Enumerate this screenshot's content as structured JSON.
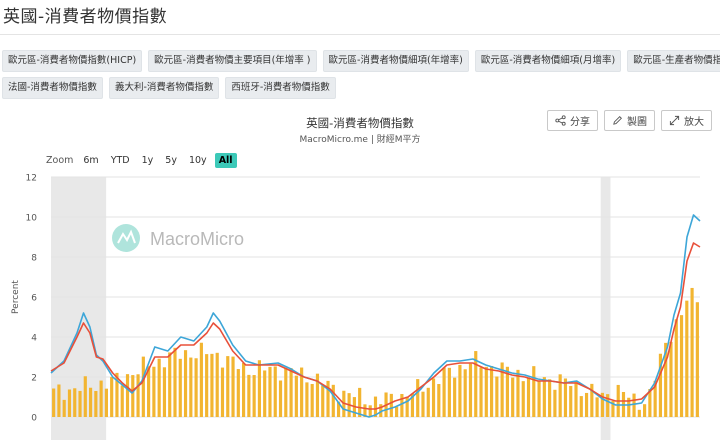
{
  "page": {
    "title": "英國-消費者物價指數"
  },
  "tags": {
    "row1": [
      "歐元區-消費者物價指數(HICP)",
      "歐元區-消費者物價主要項目(年增率 )",
      "歐元區-消費者物價細項(年增率)",
      "歐元區-消費者物價細項(月增率)",
      "歐元區-生產者物價指數"
    ],
    "row2": [
      "法國-消費者物價指數",
      "義大利-消費者物價指數",
      "西班牙-消費者物價指數"
    ]
  },
  "actions": {
    "share": "分享",
    "make_chart": "製圖",
    "enlarge": "放大"
  },
  "chart": {
    "title": "英國-消費者物價指數",
    "subtitle": "MacroMicro.me | 財經M平方",
    "watermark": "MacroMicro"
  },
  "zoom": {
    "label": "Zoom",
    "options": [
      "6m",
      "YTD",
      "1y",
      "5y",
      "10y",
      "All"
    ],
    "active": "All"
  },
  "chart_data": {
    "type": "line",
    "ylabel": "Percent",
    "ylim": [
      0,
      12
    ],
    "yticks": [
      0,
      2,
      4,
      6,
      8,
      10,
      12
    ],
    "grid": true,
    "shaded_periods": [
      [
        0,
        0.085
      ],
      [
        0.847,
        0.862
      ]
    ],
    "colors": {
      "series_blue": "#3da6d8",
      "series_red": "#e8503a",
      "bars": "#f2b531",
      "shade": "#e8e8e8"
    },
    "series": [
      {
        "style": "line",
        "color": "#3da6d8",
        "x": [
          0,
          0.02,
          0.04,
          0.05,
          0.06,
          0.07,
          0.08,
          0.095,
          0.11,
          0.125,
          0.14,
          0.16,
          0.18,
          0.2,
          0.22,
          0.24,
          0.25,
          0.26,
          0.28,
          0.3,
          0.32,
          0.35,
          0.37,
          0.39,
          0.41,
          0.43,
          0.45,
          0.47,
          0.49,
          0.5,
          0.51,
          0.53,
          0.55,
          0.57,
          0.59,
          0.61,
          0.63,
          0.65,
          0.67,
          0.69,
          0.71,
          0.73,
          0.75,
          0.77,
          0.79,
          0.81,
          0.83,
          0.85,
          0.87,
          0.89,
          0.91,
          0.93,
          0.95,
          0.96,
          0.97,
          0.98,
          0.99,
          1.0
        ],
        "values": [
          2.2,
          2.8,
          4.2,
          5.2,
          4.5,
          3.1,
          2.8,
          2.0,
          1.6,
          1.2,
          1.8,
          3.5,
          3.3,
          4.0,
          3.8,
          4.5,
          5.2,
          4.8,
          3.6,
          2.8,
          2.6,
          2.7,
          2.4,
          2.0,
          1.8,
          1.3,
          0.4,
          0.2,
          0.0,
          0.1,
          0.3,
          0.5,
          0.8,
          1.4,
          2.2,
          2.8,
          2.8,
          2.9,
          2.6,
          2.4,
          2.2,
          2.1,
          1.9,
          1.8,
          1.7,
          1.8,
          1.4,
          0.9,
          0.6,
          0.6,
          0.7,
          1.7,
          3.5,
          5.1,
          6.2,
          9.0,
          10.1,
          9.8
        ]
      },
      {
        "style": "line",
        "color": "#e8503a",
        "x": [
          0,
          0.02,
          0.04,
          0.05,
          0.06,
          0.07,
          0.08,
          0.095,
          0.11,
          0.125,
          0.14,
          0.16,
          0.18,
          0.2,
          0.22,
          0.24,
          0.25,
          0.26,
          0.28,
          0.3,
          0.32,
          0.35,
          0.37,
          0.39,
          0.41,
          0.43,
          0.45,
          0.47,
          0.49,
          0.5,
          0.51,
          0.53,
          0.55,
          0.57,
          0.59,
          0.61,
          0.63,
          0.65,
          0.67,
          0.69,
          0.71,
          0.73,
          0.75,
          0.77,
          0.79,
          0.81,
          0.83,
          0.85,
          0.87,
          0.89,
          0.91,
          0.93,
          0.95,
          0.96,
          0.97,
          0.98,
          0.99,
          1.0
        ],
        "values": [
          2.3,
          2.7,
          4.0,
          4.7,
          4.2,
          3.0,
          2.9,
          2.2,
          1.7,
          1.3,
          1.7,
          3.0,
          3.0,
          3.6,
          3.6,
          4.2,
          4.7,
          4.4,
          3.3,
          2.6,
          2.6,
          2.6,
          2.3,
          2.0,
          1.8,
          1.4,
          0.7,
          0.5,
          0.4,
          0.4,
          0.5,
          0.8,
          1.0,
          1.5,
          2.0,
          2.6,
          2.7,
          2.7,
          2.4,
          2.3,
          2.1,
          2.0,
          1.8,
          1.8,
          1.7,
          1.7,
          1.4,
          1.0,
          0.8,
          0.8,
          0.9,
          1.5,
          3.0,
          4.4,
          5.5,
          7.8,
          8.7,
          8.5
        ]
      },
      {
        "style": "bar",
        "color": "#f2b531",
        "count": 123,
        "x": [
          0,
          0.05,
          0.1,
          0.15,
          0.2,
          0.25,
          0.3,
          0.35,
          0.4,
          0.45,
          0.5,
          0.55,
          0.6,
          0.65,
          0.7,
          0.75,
          0.8,
          0.85,
          0.87,
          0.9,
          0.92,
          0.95,
          0.97,
          0.98,
          0.99,
          1.0
        ],
        "values": [
          1.2,
          1.5,
          1.8,
          2.6,
          3.2,
          3.2,
          2.4,
          2.4,
          2.0,
          1.2,
          0.8,
          1.1,
          2.0,
          2.8,
          2.3,
          2.0,
          1.7,
          1.0,
          1.4,
          0.8,
          0.8,
          4.0,
          5.0,
          5.8,
          6.1,
          6.2
        ]
      }
    ]
  }
}
